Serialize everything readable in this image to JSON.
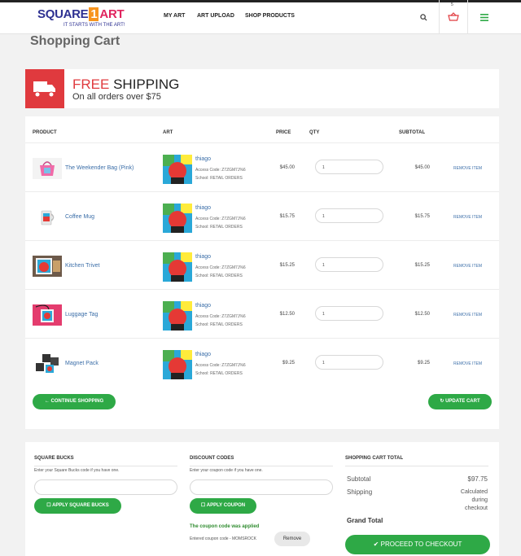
{
  "header": {
    "logo_main": "SQUARE",
    "logo_one": "1",
    "logo_art": "ART",
    "logo_tagline": "IT STARTS WITH THE ART!",
    "nav": [
      "MY ART",
      "ART UPLOAD",
      "SHOP PRODUCTS"
    ],
    "cart_count": "5"
  },
  "page_title": "Shopping Cart",
  "shipping": {
    "free": "FREE",
    "shipping": "SHIPPING",
    "subtitle": "On all orders over $75"
  },
  "table": {
    "headers": {
      "product": "PRODUCT",
      "art": "ART",
      "price": "PRICE",
      "qty": "QTY",
      "subtotal": "SUBTOTAL"
    },
    "rows": [
      {
        "name": "The Weekender Bag (Pink)",
        "art": "thiago",
        "access": "Access Code: Z7ZGM7J%6",
        "school": "School: RETAIL ORDERS",
        "price": "$45.00",
        "qty": "1",
        "subtotal": "$45.00",
        "remove": "REMOVE ITEM"
      },
      {
        "name": "Coffee Mug",
        "art": "thiago",
        "access": "Access Code: Z7ZGM7J%6",
        "school": "School: RETAIL ORDERS",
        "price": "$15.75",
        "qty": "1",
        "subtotal": "$15.75",
        "remove": "REMOVE ITEM"
      },
      {
        "name": "Kitchen Trivet",
        "art": "thiago",
        "access": "Access Code: Z7ZGM7J%6",
        "school": "School: RETAIL ORDERS",
        "price": "$15.25",
        "qty": "1",
        "subtotal": "$15.25",
        "remove": "REMOVE ITEM"
      },
      {
        "name": "Luggage Tag",
        "art": "thiago",
        "access": "Access Code: Z7ZGM7J%6",
        "school": "School: RETAIL ORDERS",
        "price": "$12.50",
        "qty": "1",
        "subtotal": "$12.50",
        "remove": "REMOVE ITEM"
      },
      {
        "name": "Magnet Pack",
        "art": "thiago",
        "access": "Access Code: Z7ZGM7J%6",
        "school": "School: RETAIL ORDERS",
        "price": "$9.25",
        "qty": "1",
        "subtotal": "$9.25",
        "remove": "REMOVE ITEM"
      }
    ],
    "continue_label": "CONTINUE SHOPPING",
    "update_label": "UPDATE CART"
  },
  "square_bucks": {
    "title": "SQUARE BUCKS",
    "subtitle": "Enter your Square Bucks code if you have one.",
    "button": "APPLY SQUARE BUCKS"
  },
  "discount": {
    "title": "DISCOUNT CODES",
    "subtitle": "Enter your coupon code if you have one.",
    "button": "APPLY COUPON",
    "applied_msg": "The coupon code was applied",
    "entered": "Entered coupon code - MOMSROCK",
    "remove": "Remove"
  },
  "totals": {
    "title": "SHOPPING CART TOTAL",
    "subtotal_label": "Subtotal",
    "subtotal_value": "$97.75",
    "shipping_label": "Shipping",
    "shipping_value": [
      "Calculated",
      "during",
      "checkout"
    ],
    "grand_total_label": "Grand Total",
    "checkout_label": "PROCEED TO CHECKOUT"
  },
  "colors": {
    "accent_green": "#2ea946",
    "brand_red": "#e03a3e",
    "link_blue": "#3b6ea8"
  }
}
